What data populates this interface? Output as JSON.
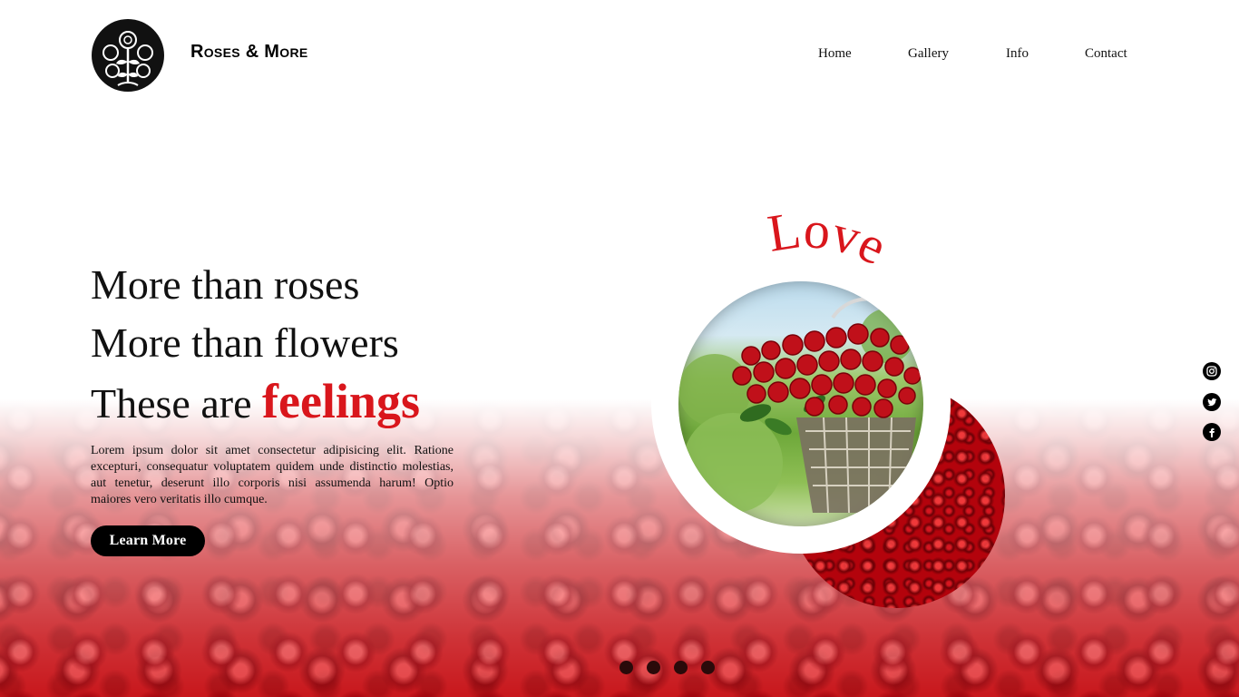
{
  "header": {
    "brand": "Roses & More",
    "logo_icon": "rose-logo-icon",
    "nav": [
      {
        "label": "Home"
      },
      {
        "label": "Gallery"
      },
      {
        "label": "Info"
      },
      {
        "label": "Contact"
      }
    ]
  },
  "hero": {
    "line1": "More than roses",
    "line2": "More than flowers",
    "line3_prefix": "These are ",
    "line3_accent": "feelings",
    "body": "Lorem ipsum dolor sit amet consectetur adipisicing elit. Ratione excepturi, consequatur voluptatem quidem unde distinctio molestias, aut tenetur, deserunt illo corporis nisi assumenda harum! Optio maiores vero veritatis illo cumque.",
    "cta_label": "Learn More"
  },
  "visual": {
    "curved_word": "Love",
    "photo": "rose-basket-photo",
    "accent_image": "rose-field-circle"
  },
  "social": [
    {
      "icon": "instagram-icon"
    },
    {
      "icon": "twitter-icon"
    },
    {
      "icon": "facebook-icon"
    }
  ],
  "slider": {
    "dots": 4
  },
  "colors": {
    "accent": "#d9161c",
    "text": "#111111",
    "button_bg": "#000000",
    "background": "#ffffff"
  }
}
